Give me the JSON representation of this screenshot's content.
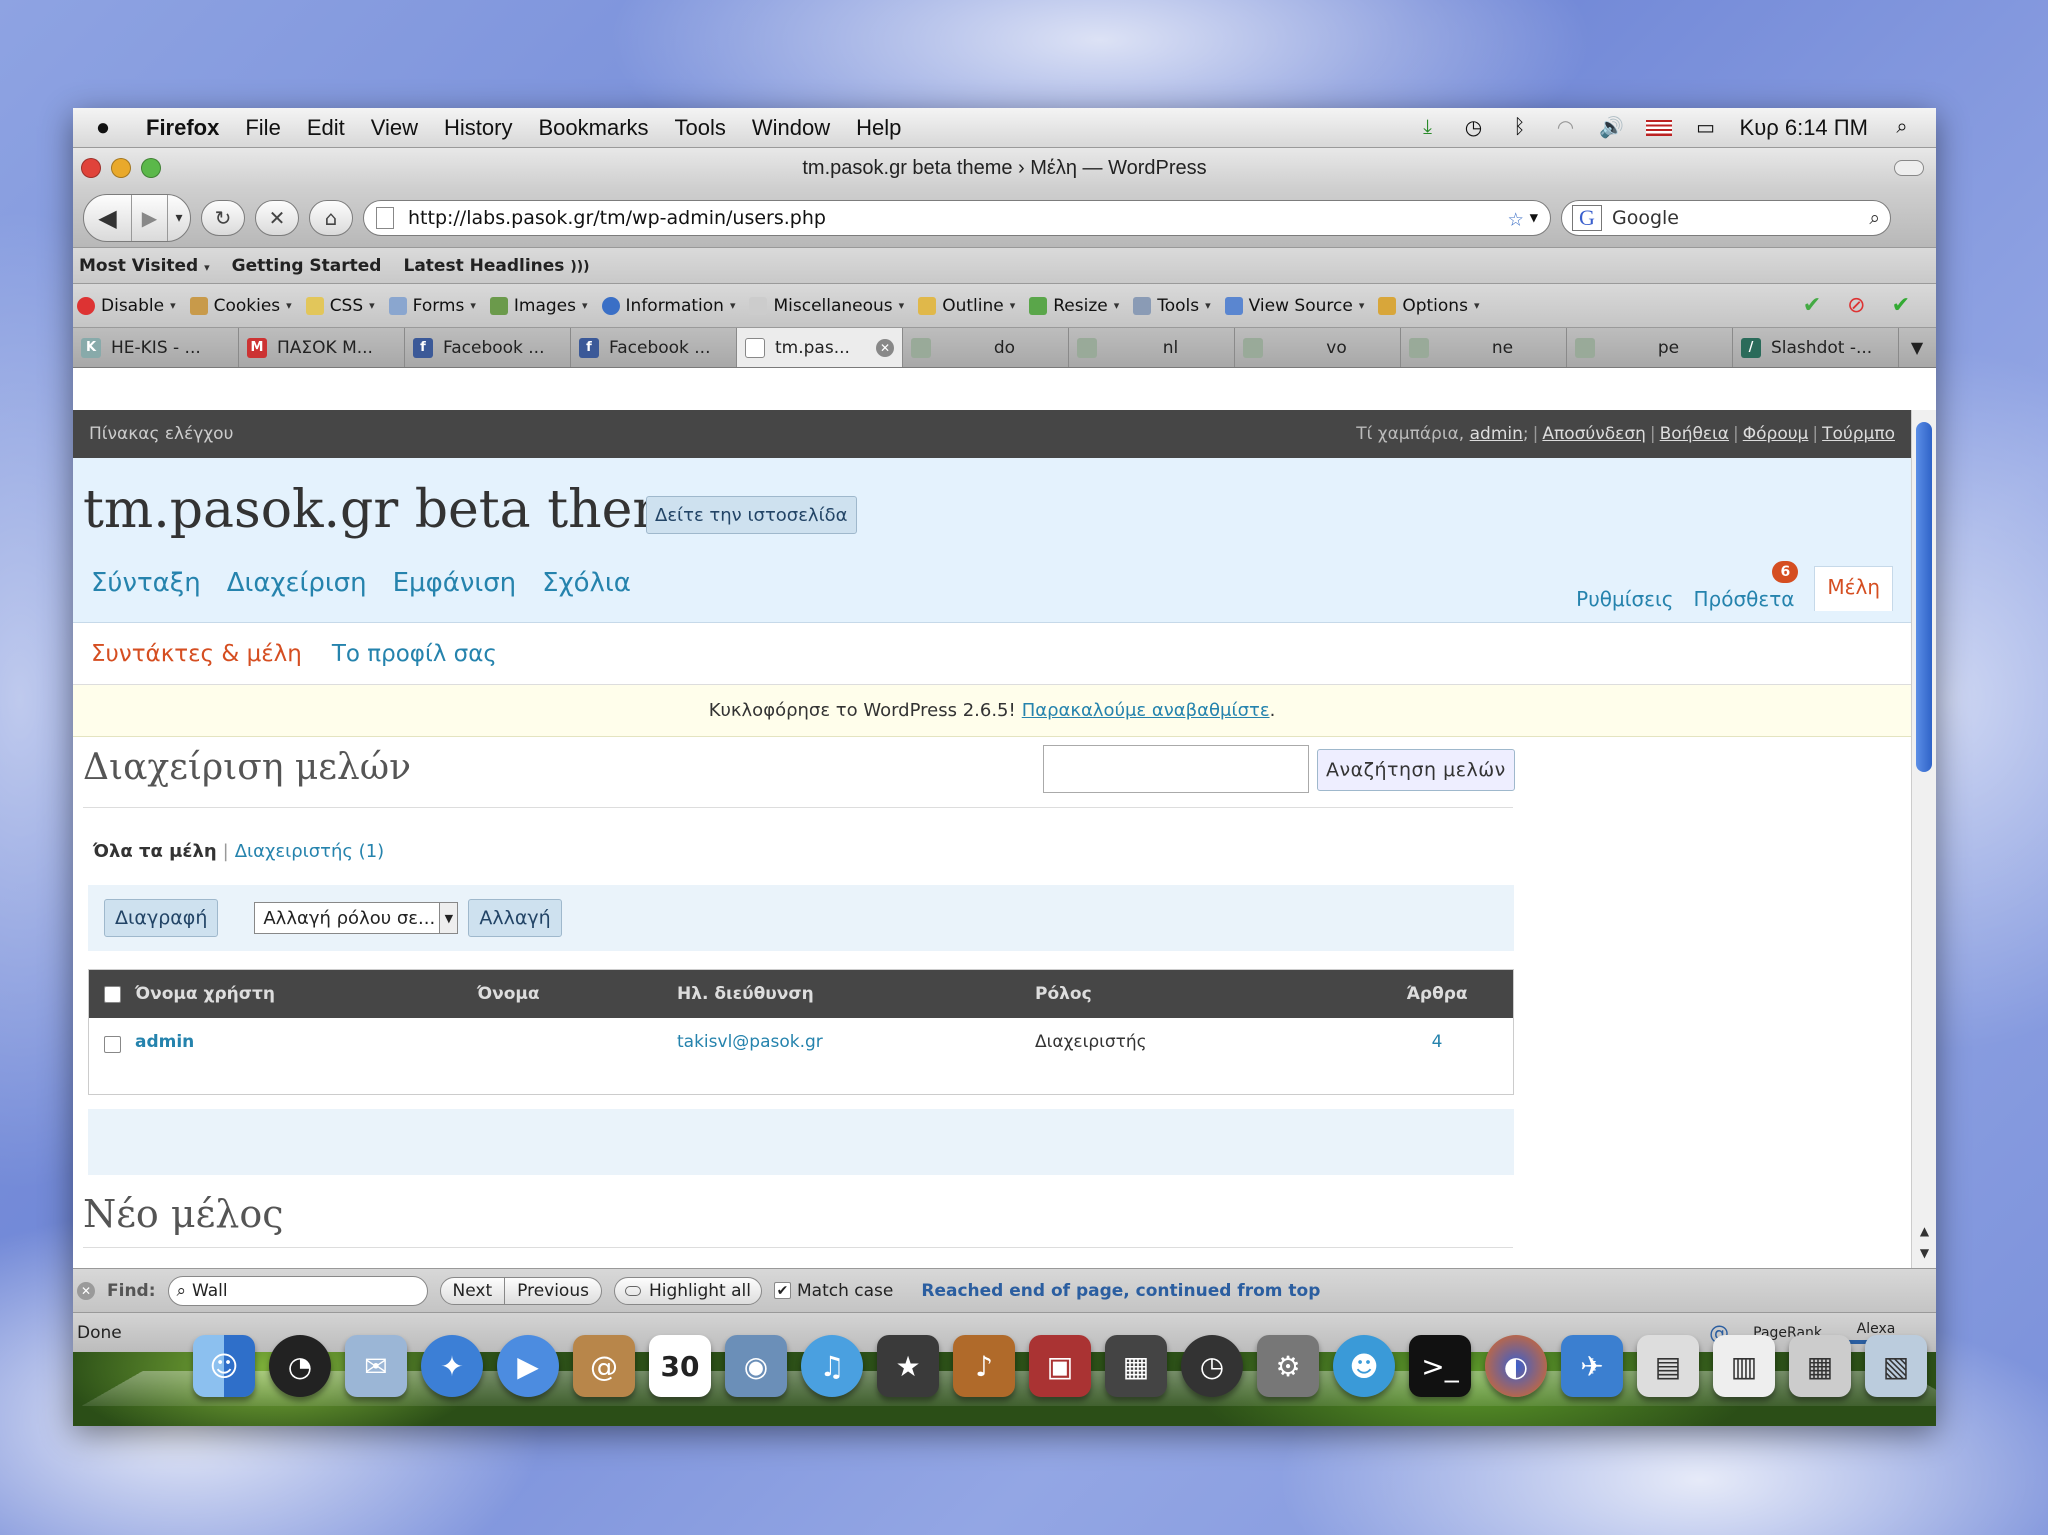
{
  "menubar": {
    "items": [
      "Firefox",
      "File",
      "Edit",
      "View",
      "History",
      "Bookmarks",
      "Tools",
      "Window",
      "Help"
    ],
    "clock": "Κυρ 6:14 ΠΜ"
  },
  "window": {
    "title": "tm.pasok.gr beta theme › Μέλη — WordPress"
  },
  "nav": {
    "url": "http://labs.pasok.gr/tm/wp-admin/users.php",
    "search_placeholder": "Google"
  },
  "bookmarks": [
    "Most Visited",
    "Getting Started",
    "Latest Headlines"
  ],
  "webdev": [
    "Disable",
    "Cookies",
    "CSS",
    "Forms",
    "Images",
    "Information",
    "Miscellaneous",
    "Outline",
    "Resize",
    "Tools",
    "View Source",
    "Options"
  ],
  "tabs": [
    {
      "label": "HE-KIS - ..."
    },
    {
      "label": "ΠΑΣΟΚ Μ..."
    },
    {
      "label": "Facebook ..."
    },
    {
      "label": "Facebook ..."
    },
    {
      "label": "tm.pas..."
    },
    {
      "label": "do"
    },
    {
      "label": "nl"
    },
    {
      "label": "vo"
    },
    {
      "label": "ne"
    },
    {
      "label": "pe"
    },
    {
      "label": "Slashdot -..."
    }
  ],
  "wp": {
    "dashboard": "Πίνακας ελέγχου",
    "greeting": "Τί χαμπάρια,",
    "user": "admin",
    "header_links": [
      "Αποσύνδεση",
      "Βοήθεια",
      "Φόρουμ",
      "Τούρμπο"
    ],
    "site_title": "tm.pasok.gr beta theme",
    "visit_site": "Δείτε την ιστοσελίδα",
    "main_menu": [
      "Σύνταξη",
      "Διαχείριση",
      "Εμφάνιση",
      "Σχόλια"
    ],
    "side_menu": {
      "settings": "Ρυθμίσεις",
      "plugins": "Πρόσθετα",
      "plugins_count": "6",
      "users": "Μέλη"
    },
    "submenu": {
      "authors": "Συντάκτες & μέλη",
      "profile": "Το προφίλ σας"
    },
    "update_nag": {
      "text": "Κυκλοφόρησε το WordPress 2.6.5!",
      "link": "Παρακαλούμε αναβαθμίστε",
      "end": "."
    },
    "page_heading": "Διαχείριση μελών",
    "search_button": "Αναζήτηση μελών",
    "filters": {
      "all": "Όλα τα μέλη",
      "admins": "Διαχειριστής (1)"
    },
    "actions": {
      "delete": "Διαγραφή",
      "role_select": "Αλλαγή ρόλου σε...",
      "change": "Αλλαγή"
    },
    "table": {
      "headers": [
        "Όνομα χρήστη",
        "Όνομα",
        "Ηλ. διεύθυνση",
        "Ρόλος",
        "Άρθρα"
      ],
      "rows": [
        {
          "username": "admin",
          "name": "",
          "email": "takisvl@pasok.gr",
          "role": "Διαχειριστής",
          "posts": "4"
        }
      ]
    },
    "new_user_heading": "Νέο μέλος"
  },
  "findbar": {
    "label": "Find:",
    "value": "Wall",
    "next": "Next",
    "previous": "Previous",
    "highlight": "Highlight all",
    "match_case": "Match case",
    "status": "Reached end of page, continued from top"
  },
  "statusbar": {
    "status": "Done",
    "pagerank": "PageRank",
    "alexa": "Alexa"
  }
}
